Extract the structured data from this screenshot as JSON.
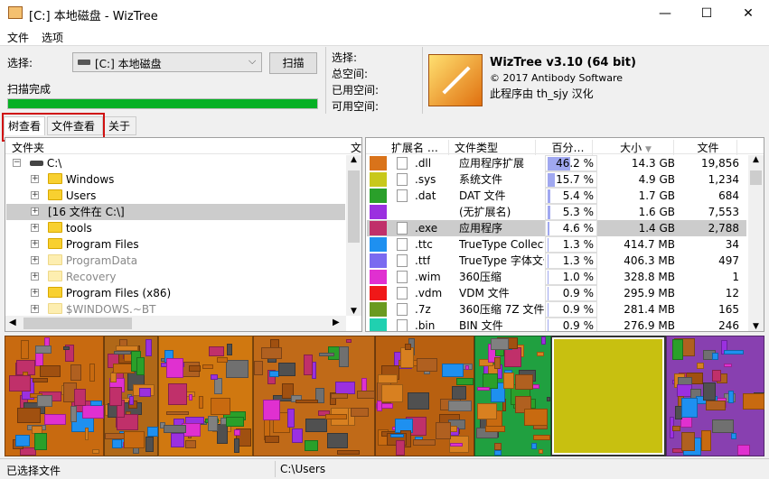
{
  "window": {
    "title": "[C:] 本地磁盘  - WizTree",
    "minimize": "—",
    "maximize": "☐",
    "close": "✕"
  },
  "menu": [
    "文件",
    "选项"
  ],
  "top": {
    "select_label": "选择:",
    "drive": "[C:] 本地磁盘",
    "scan": "扫描",
    "status": "扫描完成",
    "progress": 1.0,
    "info": [
      "选择:",
      "总空间:",
      "已用空间:",
      "可用空间:"
    ],
    "about_title": "WizTree v3.10 (64 bit)",
    "about_copy": "© 2017 Antibody Software",
    "about_trans": "此程序由 th_sjy 汉化"
  },
  "tabs": [
    "树查看",
    "文件查看",
    "关于"
  ],
  "tree": {
    "header": "文件夹",
    "header2": "文",
    "items": [
      {
        "label": "C:\\",
        "type": "drive",
        "level": 0,
        "exp": "−"
      },
      {
        "label": "Windows",
        "type": "folder",
        "level": 1,
        "exp": "+"
      },
      {
        "label": "Users",
        "type": "folder",
        "level": 1,
        "exp": "+"
      },
      {
        "label": "[16 文件在       C:\\]",
        "type": "files",
        "level": 1,
        "exp": "+",
        "selected": true
      },
      {
        "label": "tools",
        "type": "folder",
        "level": 1,
        "exp": "+"
      },
      {
        "label": "Program Files",
        "type": "folder",
        "level": 1,
        "exp": "+"
      },
      {
        "label": "ProgramData",
        "type": "dim",
        "level": 1,
        "exp": "+"
      },
      {
        "label": "Recovery",
        "type": "dim",
        "level": 1,
        "exp": "+"
      },
      {
        "label": "Program Files (x86)",
        "type": "folder",
        "level": 1,
        "exp": "+"
      },
      {
        "label": "$WINDOWS.~BT",
        "type": "dim",
        "level": 1,
        "exp": "+"
      }
    ]
  },
  "ext": {
    "headers": [
      "扩展名 …",
      "文件类型",
      "百分…",
      "大小",
      "文件"
    ],
    "rows": [
      {
        "color": "#d9731a",
        "ext": ".dll",
        "type": "应用程序扩展",
        "pct": "46.2 %",
        "p": 46.2,
        "size": "14.3 GB",
        "files": "19,856"
      },
      {
        "color": "#c8c81a",
        "ext": ".sys",
        "type": "系统文件",
        "pct": "15.7 %",
        "p": 15.7,
        "size": "4.9 GB",
        "files": "1,234"
      },
      {
        "color": "#2aa02a",
        "ext": ".dat",
        "type": "DAT 文件",
        "pct": "5.4 %",
        "p": 5.4,
        "size": "1.7 GB",
        "files": "684"
      },
      {
        "color": "#9b30e0",
        "ext": "",
        "type": "(无扩展名)",
        "pct": "5.3 %",
        "p": 5.3,
        "size": "1.6 GB",
        "files": "7,553"
      },
      {
        "color": "#c0306a",
        "ext": ".exe",
        "type": "应用程序",
        "pct": "4.6 %",
        "p": 4.6,
        "size": "1.4 GB",
        "files": "2,788",
        "selected": true
      },
      {
        "color": "#1e90f0",
        "ext": ".ttc",
        "type": "TrueType Collectio",
        "pct": "1.3 %",
        "p": 1.3,
        "size": "414.7 MB",
        "files": "34"
      },
      {
        "color": "#7a6af0",
        "ext": ".ttf",
        "type": "TrueType 字体文件",
        "pct": "1.3 %",
        "p": 1.3,
        "size": "406.3 MB",
        "files": "497"
      },
      {
        "color": "#e030d0",
        "ext": ".wim",
        "type": "360压缩",
        "pct": "1.0 %",
        "p": 1.0,
        "size": "328.8 MB",
        "files": "1"
      },
      {
        "color": "#f01818",
        "ext": ".vdm",
        "type": "VDM 文件",
        "pct": "0.9 %",
        "p": 0.9,
        "size": "295.9 MB",
        "files": "12"
      },
      {
        "color": "#6a9a20",
        "ext": ".7z",
        "type": "360压缩 7Z 文件",
        "pct": "0.9 %",
        "p": 0.9,
        "size": "281.4 MB",
        "files": "165"
      },
      {
        "color": "#20d0b0",
        "ext": ".bin",
        "type": "BIN 文件",
        "pct": "0.9 %",
        "p": 0.9,
        "size": "276.9 MB",
        "files": "246"
      }
    ]
  },
  "status": {
    "left": "已选择文件",
    "path": "C:\\Users"
  }
}
